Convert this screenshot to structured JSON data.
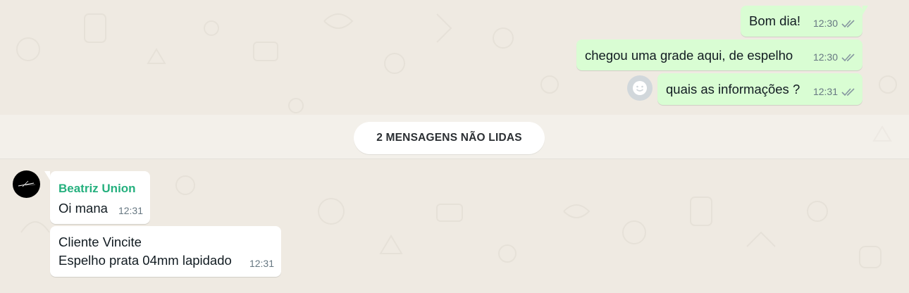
{
  "chat": {
    "outgoing": [
      {
        "text": "Bom dia!",
        "time": "12:30"
      },
      {
        "text": "chegou uma grade aqui, de espelho",
        "time": "12:30"
      },
      {
        "text": "quais as informações ?",
        "time": "12:31"
      }
    ],
    "unread_divider": "2 MENSAGENS NÃO LIDAS",
    "incoming": [
      {
        "sender": "Beatriz Union",
        "text": "Oi mana",
        "time": "12:31"
      },
      {
        "line1": "Cliente Vincite",
        "line2": "Espelho prata 04mm lapidado",
        "time": "12:31"
      }
    ]
  },
  "icons": {
    "read_receipt": "double-check-icon",
    "emoji": "smiley-icon",
    "avatar": "contact-avatar"
  },
  "colors": {
    "background": "#efeae2",
    "outgoing_bubble": "#d9fdd3",
    "incoming_bubble": "#ffffff",
    "sender_name": "#25b07e",
    "timestamp": "#667781"
  }
}
